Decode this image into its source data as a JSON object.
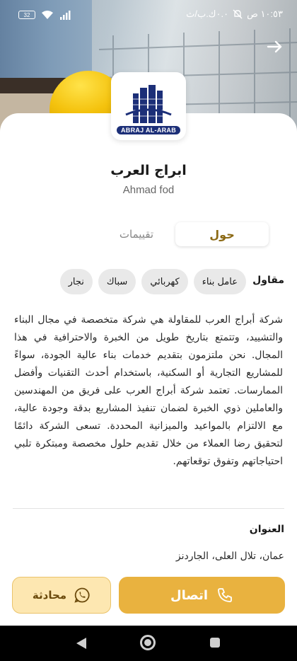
{
  "status_bar": {
    "battery": "32",
    "time": "١٠:٥٣ ص",
    "network_speed": "٠.٠ك.ب/ث"
  },
  "company": {
    "name": "ابراج العرب",
    "owner": "Ahmad fod",
    "logo_text": "ABRAJ AL-ARAB"
  },
  "tabs": [
    {
      "label": "حول",
      "active": true
    },
    {
      "label": "تقييمات",
      "active": false
    }
  ],
  "skills": {
    "label": "مقاول",
    "items": [
      "عامل بناء",
      "كهربائي",
      "سباك",
      "نجار"
    ]
  },
  "description": "شركة أبراج العرب للمقاولة هي شركة متخصصة في مجال البناء والتشييد، وتتمتع بتاريخ طويل من الخبرة والاحترافية في هذا المجال. نحن ملتزمون بتقديم خدمات بناء عالية الجودة، سواءً للمشاريع التجارية أو السكنية، باستخدام أحدث التقنيات وأفضل الممارسات. تعتمد شركة أبراج العرب على فريق من المهندسين والعاملين ذوي الخبرة لضمان تنفيذ المشاريع بدقة وجودة عالية، مع الالتزام بالمواعيد والميزانية المحددة. تسعى الشركة دائمًا لتحقيق رضا العملاء من خلال تقديم حلول مخصصة ومبتكرة تلبي احتياجاتهم وتفوق توقعاتهم.",
  "address": {
    "title": "العنوان",
    "value": "عمان، تلال العلى، الجاردنز"
  },
  "actions": {
    "call_label": "اتصال",
    "chat_label": "محادثة"
  },
  "colors": {
    "primary": "#e9b23f",
    "primary_light": "#fde7b1",
    "tab_active_text": "#8b6914",
    "logo_blue": "#1c2f78"
  }
}
